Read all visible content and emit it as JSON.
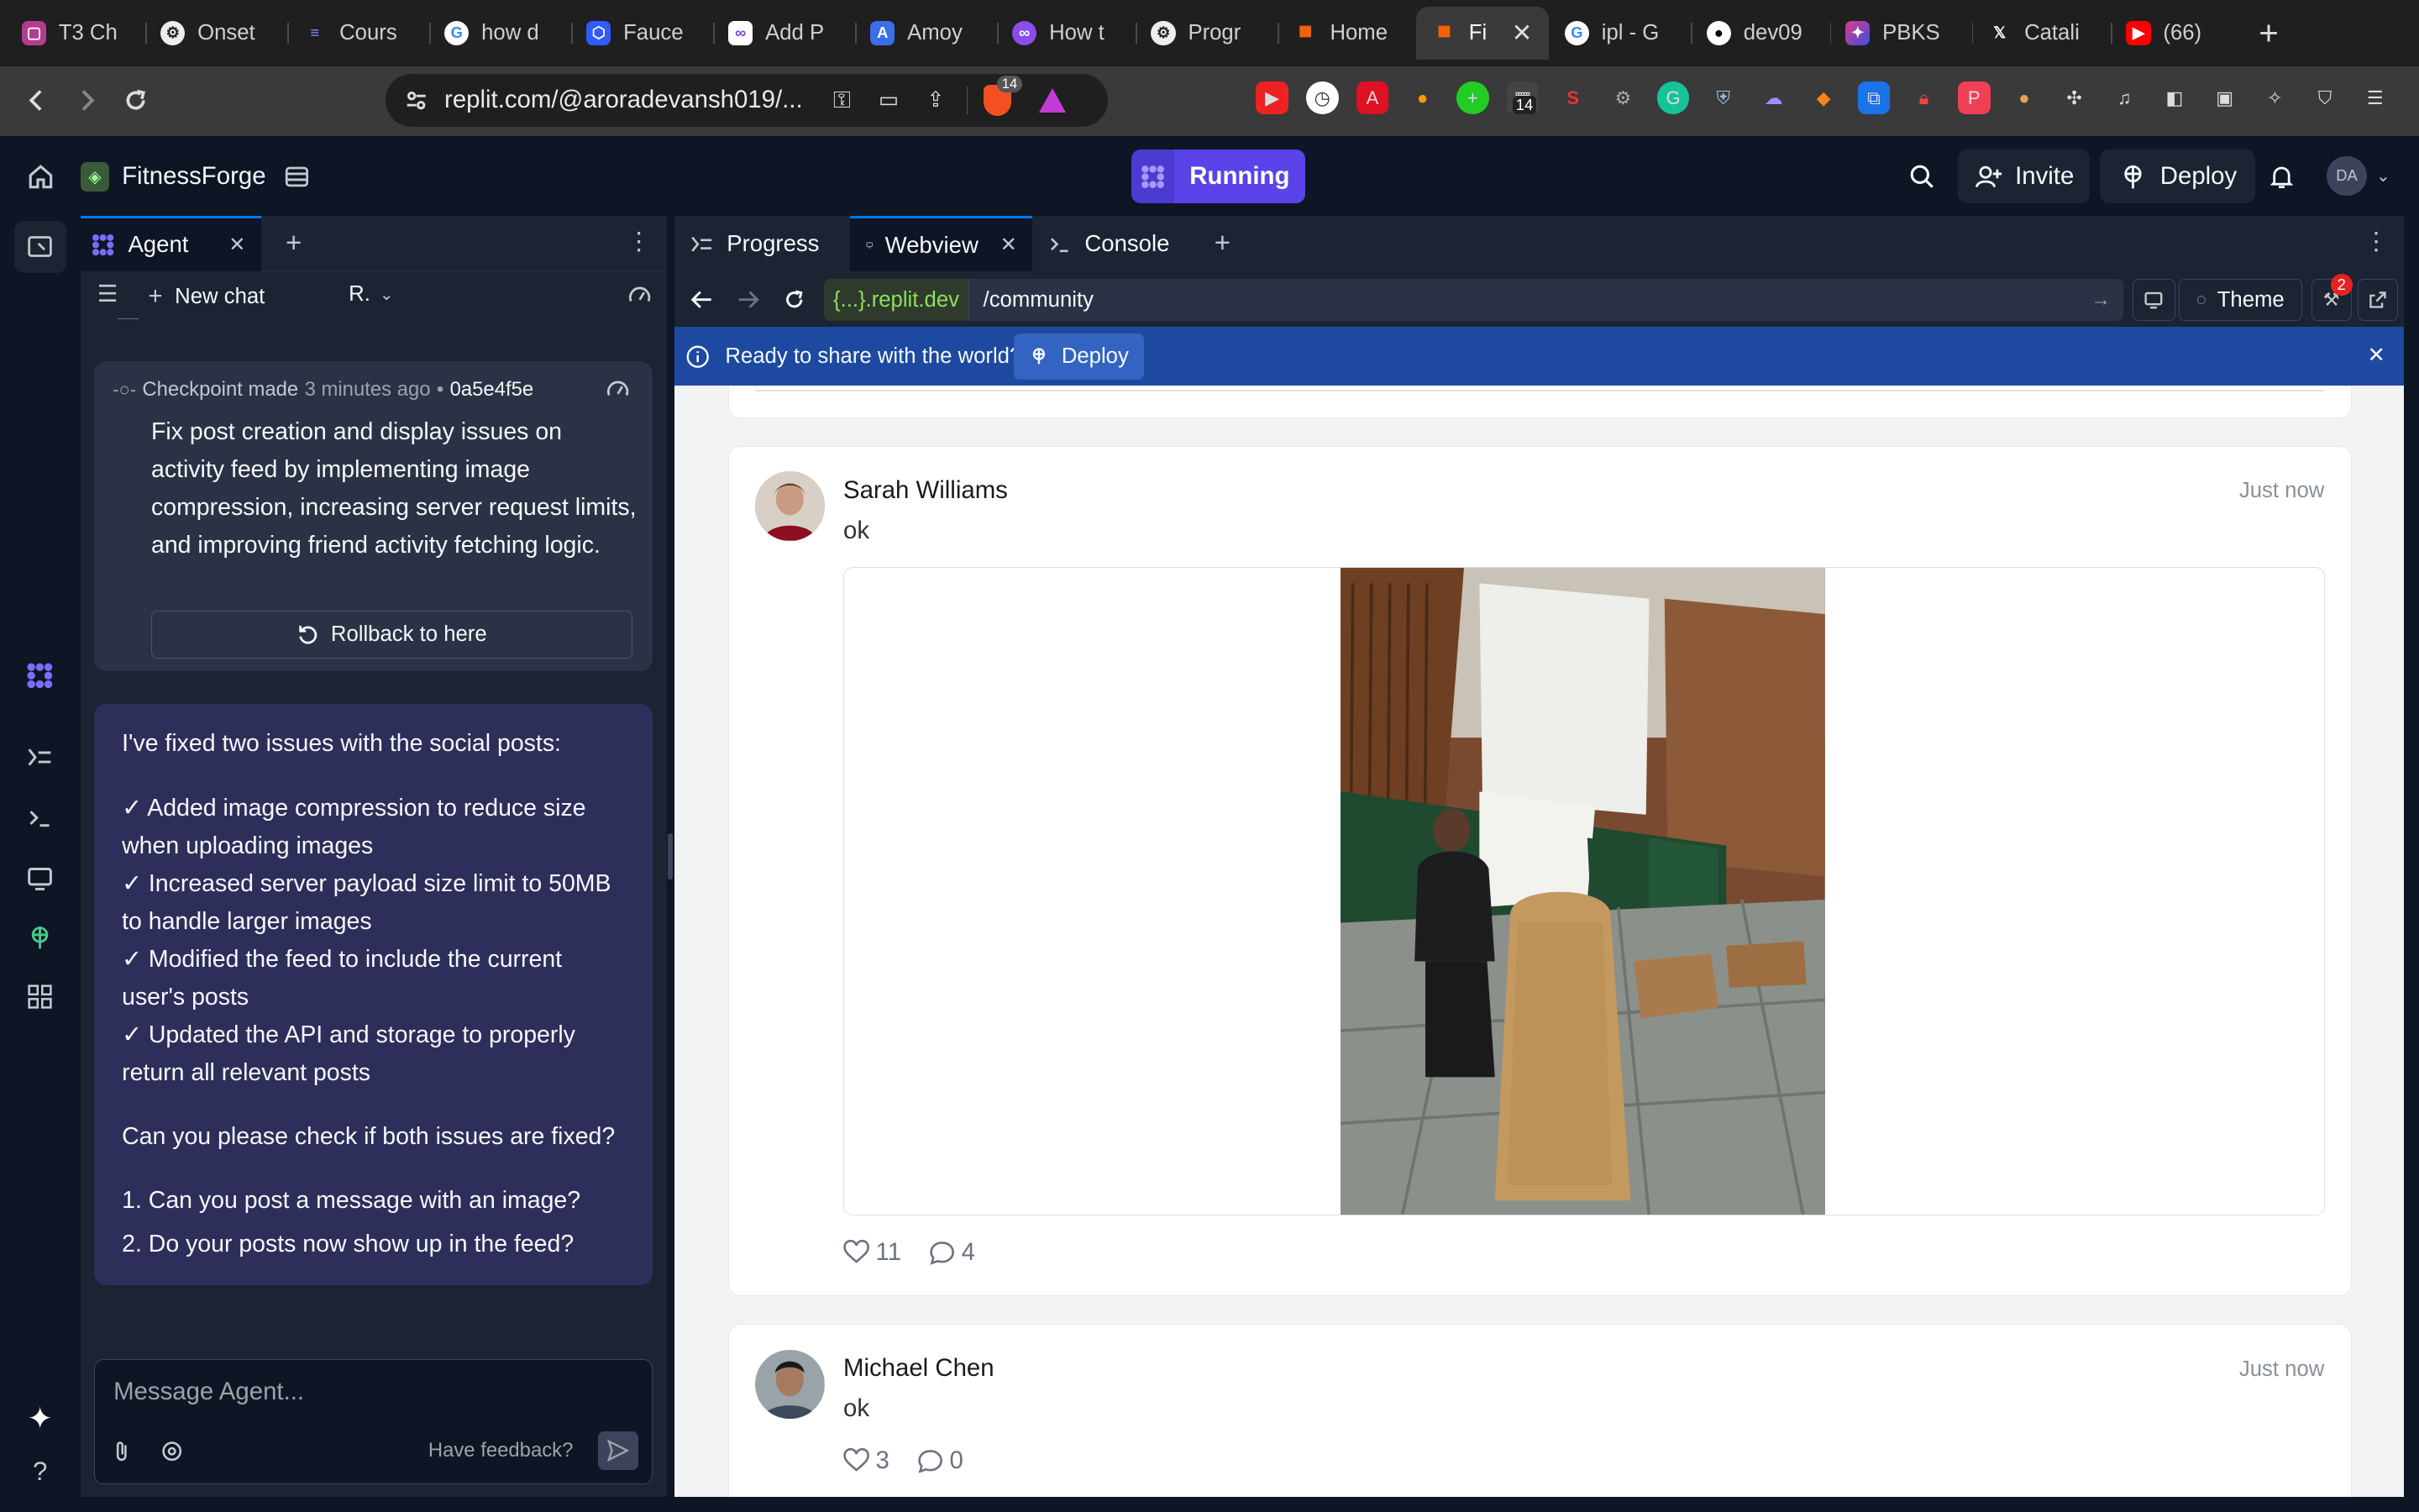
{
  "browser": {
    "tabs": [
      {
        "label": "T3 Ch",
        "icon": "t3-chat-icon",
        "color": "#b33c8e"
      },
      {
        "label": "Onset",
        "icon": "openai-icon",
        "color": "#444"
      },
      {
        "label": "Cours",
        "icon": "coursera-icon",
        "color": "#2f6fd6"
      },
      {
        "label": "how d",
        "icon": "google-icon",
        "color": "#fff"
      },
      {
        "label": "Fauce",
        "icon": "faucet-icon",
        "color": "#2f5bff"
      },
      {
        "label": "Add P",
        "icon": "link-icon",
        "color": "#fff"
      },
      {
        "label": "Amoy",
        "icon": "amoy-icon",
        "color": "#3b6ee8"
      },
      {
        "label": "How t",
        "icon": "polygon-icon",
        "color": "#8a4de8"
      },
      {
        "label": "Progr",
        "icon": "openai-icon",
        "color": "#444"
      },
      {
        "label": "Home",
        "icon": "replit-icon",
        "color": "#f26207"
      },
      {
        "label": "Fi",
        "icon": "replit-icon",
        "color": "#f26207",
        "active": true
      },
      {
        "label": "ipl - G",
        "icon": "google-icon",
        "color": "#fff"
      },
      {
        "label": "dev09",
        "icon": "github-icon",
        "color": "#fff"
      },
      {
        "label": "PBKS",
        "icon": "pbks-icon",
        "color": "#8a2be2"
      },
      {
        "label": "Catali",
        "icon": "x-icon",
        "color": "#000"
      },
      {
        "label": "(66)",
        "icon": "youtube-icon",
        "color": "#ff0000"
      }
    ],
    "url": "replit.com/@aroradevansh019/...",
    "brave_count": "14",
    "ext_badge": "14"
  },
  "header": {
    "project_name": "FitnessForge",
    "run_label": "Running",
    "invite_label": "Invite",
    "deploy_label": "Deploy",
    "avatar_initials": "DA"
  },
  "agent": {
    "tab_label": "Agent",
    "new_chat_label": "New chat",
    "model_label": "R.",
    "checkpoint": {
      "label": "Checkpoint made",
      "time": "3 minutes ago",
      "sep": "•",
      "hash": "0a5e4f5e",
      "text": "Fix post creation and display issues on activity feed by implementing image compression, increasing server request limits, and improving friend activity fetching logic.",
      "rollback_label": "Rollback to here"
    },
    "message": {
      "intro": "I've fixed two issues with the social posts:",
      "items": [
        "✓ Added image compression to reduce size when uploading images",
        "✓ Increased server payload size limit to 50MB to handle larger images",
        "✓ Modified the feed to include the current user's posts",
        "✓ Updated the API and storage to properly return all relevant posts"
      ],
      "question": "Can you please check if both issues are fixed?",
      "q1": "1. Can you post a message with an image?",
      "q2": "2. Do your posts now show up in the feed?"
    },
    "composer_placeholder": "Message Agent...",
    "feedback_label": "Have feedback?"
  },
  "workspace": {
    "tabs": [
      {
        "label": "Progress"
      },
      {
        "label": "Webview",
        "active": true
      },
      {
        "label": "Console"
      }
    ],
    "host": "{...}.replit.dev",
    "path": "/community",
    "theme_label": "Theme",
    "badge_count": "2",
    "banner_text": "Ready to share with the world?",
    "banner_button": "Deploy"
  },
  "feed": {
    "posts": [
      {
        "name": "Sarah Williams",
        "text": "ok",
        "time": "Just now",
        "likes": "11",
        "comments": "4",
        "has_image": true
      },
      {
        "name": "Michael Chen",
        "text": "ok",
        "time": "Just now",
        "likes": "3",
        "comments": "0",
        "has_image": false
      }
    ]
  }
}
